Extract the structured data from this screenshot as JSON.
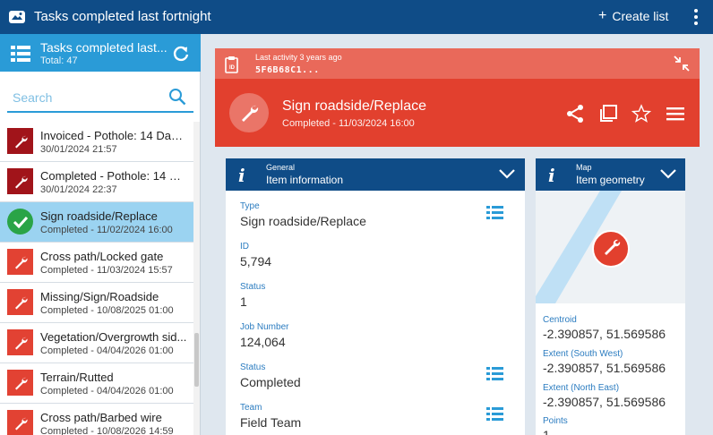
{
  "app": {
    "title": "Tasks completed last fortnight",
    "create_label": "Create list"
  },
  "list": {
    "title": "Tasks completed last...",
    "total": "Total: 47",
    "search_placeholder": "Search",
    "items": [
      {
        "name": "Invoiced - Pothole: 14 Day ...",
        "sub": "30/01/2024 21:57",
        "icon": "wrench-icon",
        "style": "dark"
      },
      {
        "name": "Completed - Pothole: 14 Da...",
        "sub": "30/01/2024 22:37",
        "icon": "wrench-icon",
        "style": "dark"
      },
      {
        "name": "Sign roadside/Replace",
        "sub": "Completed - 11/02/2024 16:00",
        "icon": "checkmark-icon",
        "style": "done"
      },
      {
        "name": "Cross path/Locked gate",
        "sub": "Completed - 11/03/2024 15:57",
        "icon": "wrench-icon",
        "style": "red"
      },
      {
        "name": "Missing/Sign/Roadside",
        "sub": "Completed - 10/08/2025 01:00",
        "icon": "wrench-icon",
        "style": "red"
      },
      {
        "name": "Vegetation/Overgrowth sid...",
        "sub": "Completed - 04/04/2026 01:00",
        "icon": "wrench-icon",
        "style": "red"
      },
      {
        "name": "Terrain/Rutted",
        "sub": "Completed - 04/04/2026 01:00",
        "icon": "wrench-icon",
        "style": "red"
      },
      {
        "name": "Cross path/Barbed wire",
        "sub": "Completed - 10/08/2026 14:59",
        "icon": "wrench-icon",
        "style": "red"
      }
    ]
  },
  "detail": {
    "activity_label": "Last activity",
    "activity_time": "3 years ago",
    "activity_code": "5F6B68C1...",
    "title": "Sign roadside/Replace",
    "subtitle": "Completed - 11/03/2024 16:00"
  },
  "general": {
    "label": "General",
    "title": "Item information",
    "fields": [
      {
        "label": "Type",
        "value": "Sign roadside/Replace"
      },
      {
        "label": "ID",
        "value": "5,794"
      },
      {
        "label": "Status",
        "value": "1"
      },
      {
        "label": "Job Number",
        "value": "124,064"
      },
      {
        "label": "Status",
        "value": "Completed"
      },
      {
        "label": "Team",
        "value": "Field Team"
      }
    ]
  },
  "map": {
    "label": "Map",
    "title": "Item geometry",
    "fields": [
      {
        "label": "Centroid",
        "value": "-2.390857, 51.569586"
      },
      {
        "label": "Extent (South West)",
        "value": "-2.390857, 51.569586"
      },
      {
        "label": "Extent (North East)",
        "value": "-2.390857, 51.569586"
      },
      {
        "label": "Points",
        "value": "1"
      }
    ]
  },
  "colors": {
    "header": "#0f4c87",
    "accent": "#2a9bd7",
    "task_red": "#e2402e",
    "task_dark": "#a1141a",
    "done_green": "#2aa447"
  }
}
